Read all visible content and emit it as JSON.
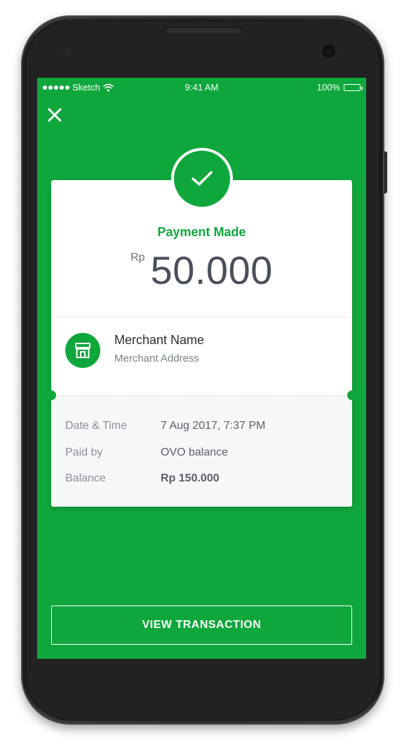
{
  "status_bar": {
    "carrier": "Sketch",
    "time": "9:41 AM",
    "battery": "100%",
    "battery_level": 1.0
  },
  "header": {
    "close_icon": "close-icon"
  },
  "payment": {
    "status": "Payment Made",
    "currency": "Rp",
    "amount": "50.000",
    "status_icon": "checkmark-icon"
  },
  "merchant": {
    "name": "Merchant Name",
    "address": "Merchant Address",
    "icon": "store-icon"
  },
  "details": [
    {
      "label": "Date & Time",
      "value": "7 Aug 2017, 7:37 PM",
      "bold": false
    },
    {
      "label": "Paid by",
      "value": "OVO balance",
      "bold": false
    },
    {
      "label": "Balance",
      "value": "Rp 150.000",
      "bold": true
    }
  ],
  "actions": {
    "view_transaction": "VIEW TRANSACTION"
  },
  "colors": {
    "brand_green": "#0fa73c",
    "card_background": "#ffffff",
    "details_background": "#f6f7f9"
  }
}
